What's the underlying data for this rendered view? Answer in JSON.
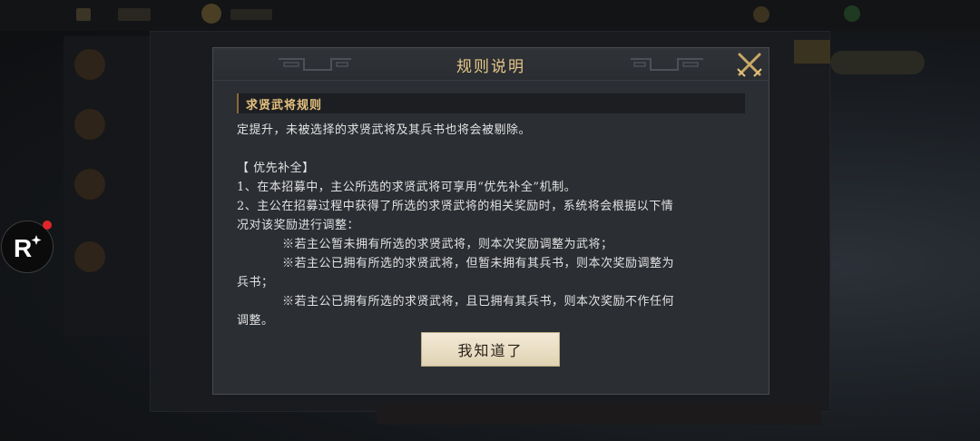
{
  "dialog": {
    "title": "规则说明",
    "section_title": "求贤武将规则",
    "lines": [
      "定提升，未被选择的求贤武将及其兵书也将会被剔除。",
      "【 优先补全】",
      "1、在本招募中，主公所选的求贤武将可享用“优先补全”机制。",
      "2、主公在招募过程中获得了所选的求贤武将的相关奖励时，系统将会根据以下情",
      "况对该奖励进行调整：",
      "※若主公暂未拥有所选的求贤武将，则本次奖励调整为武将；",
      "※若主公已拥有所选的求贤武将，但暂未拥有其兵书，则本次奖励调整为",
      "兵书；",
      "※若主公已拥有所选的求贤武将，且已拥有其兵书，则本次奖励不作任何",
      "调整。"
    ],
    "confirm_label": "我知道了",
    "close_icon": "crossed-swords-close-icon"
  },
  "colors": {
    "title": "#e8c88a",
    "section_title": "#e6c17e",
    "text": "#e2e2e2",
    "dialog_bg": "#2b2e33",
    "button_bg": "#efe4cb",
    "record_dot": "#e0262a"
  },
  "overlay": {
    "record_icon": "record-r-icon"
  }
}
